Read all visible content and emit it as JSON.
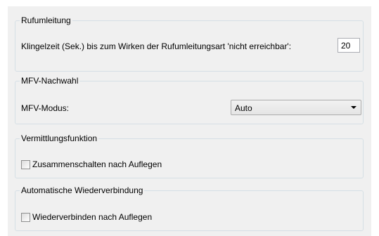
{
  "rufumleitung": {
    "legend": "Rufumleitung",
    "label": "Klingelzeit (Sek.) bis zum Wirken der Rufumleitungsart 'nicht erreichbar':",
    "value": "20"
  },
  "mfv": {
    "legend": "MFV-Nachwahl",
    "label": "MFV-Modus:",
    "selected": "Auto"
  },
  "vermittlung": {
    "legend": "Vermittlungsfunktion",
    "checkbox_label": "Zusammenschalten nach Auflegen",
    "checked": false
  },
  "wiederverbindung": {
    "legend": "Automatische Wiederverbindung",
    "checkbox_label": "Wiederverbinden nach Auflegen",
    "checked": false
  }
}
